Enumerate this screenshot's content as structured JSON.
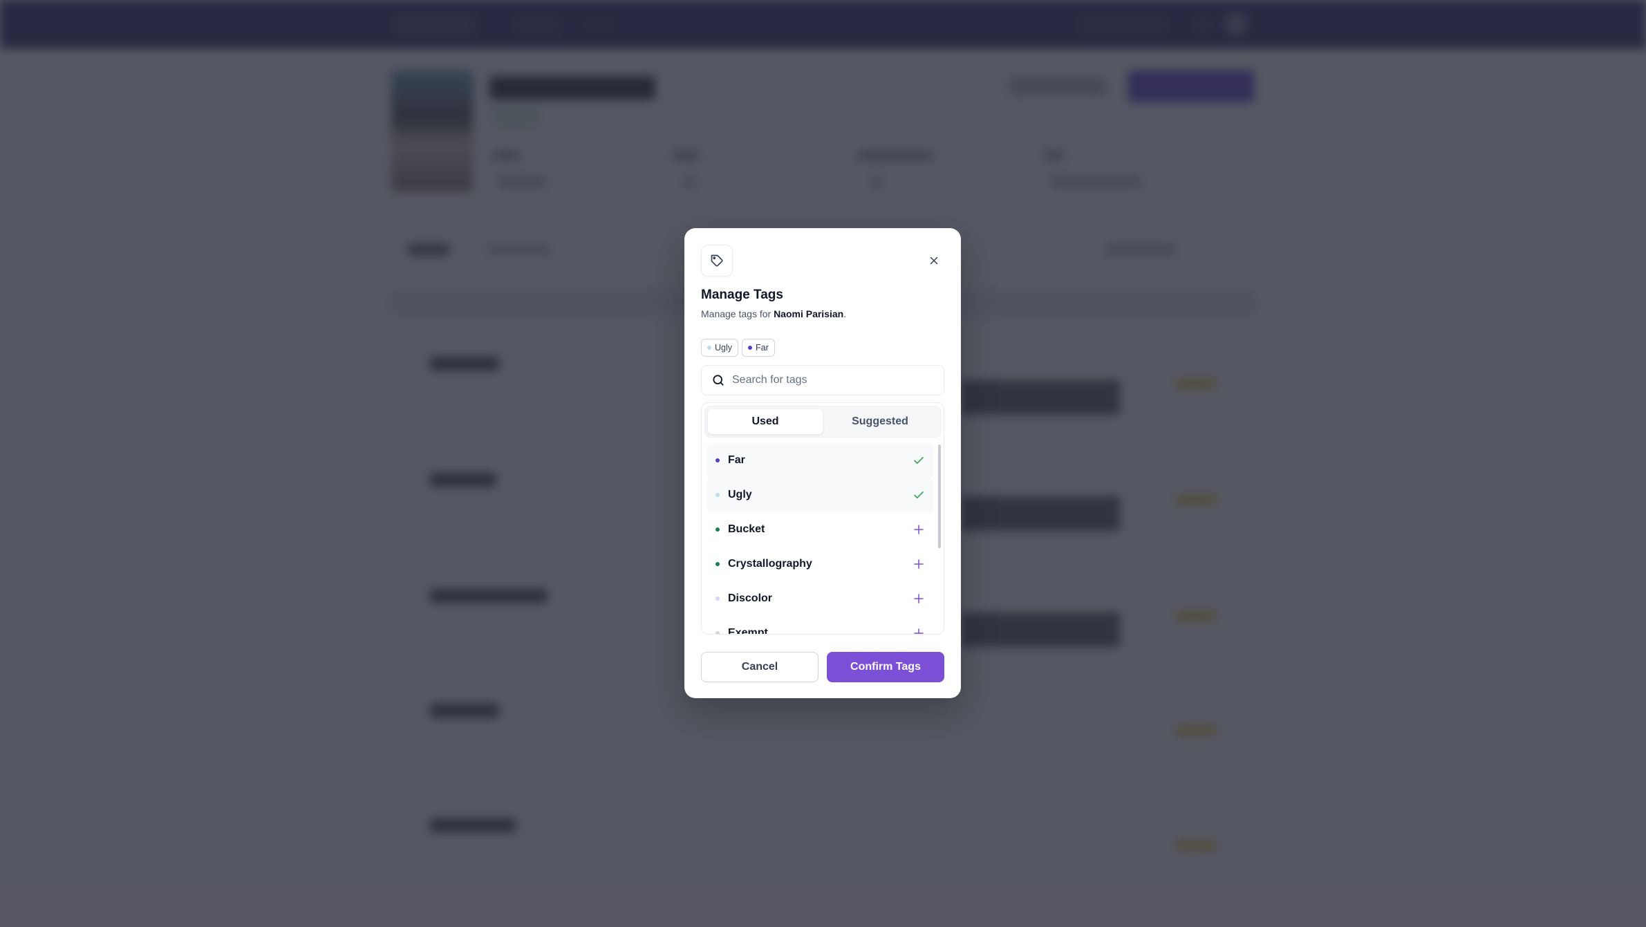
{
  "colors": {
    "nav_bg": "#2c2466",
    "accent": "#7b4fd6",
    "check": "#3aa757",
    "overlay": "#282a38"
  },
  "modal": {
    "icon": "tag-icon",
    "title": "Manage Tags",
    "subtitle_prefix": "Manage tags for ",
    "subtitle_name": "Naomi Parisian",
    "subtitle_suffix": ".",
    "selected_chips": [
      {
        "label": "Ugly",
        "color": "#bcdcf0"
      },
      {
        "label": "Far",
        "color": "#5b3fc0"
      }
    ],
    "search": {
      "placeholder": "Search for tags",
      "value": "",
      "icon": "search-icon"
    },
    "tabs": [
      {
        "label": "Used",
        "active": true
      },
      {
        "label": "Suggested",
        "active": false
      }
    ],
    "tags": [
      {
        "label": "Far",
        "color": "#5b3fc0",
        "selected": true
      },
      {
        "label": "Ugly",
        "color": "#bcdcf0",
        "selected": true
      },
      {
        "label": "Bucket",
        "color": "#17804f",
        "selected": false
      },
      {
        "label": "Crystallography",
        "color": "#17804f",
        "selected": false
      },
      {
        "label": "Discolor",
        "color": "#d8d4f4",
        "selected": false
      },
      {
        "label": "Exempt",
        "color": "#d0d5dd",
        "selected": false
      }
    ],
    "cancel_label": "Cancel",
    "confirm_label": "Confirm Tags"
  }
}
